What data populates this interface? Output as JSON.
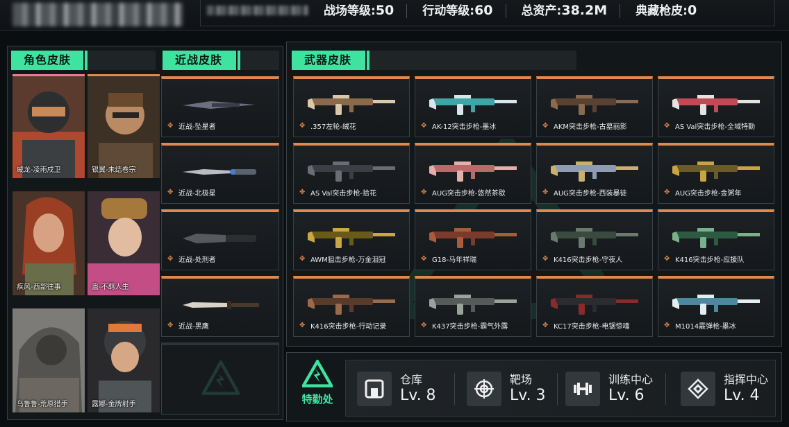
{
  "header": {
    "stats": [
      {
        "label": "战场等级:",
        "value": "50"
      },
      {
        "label": "行动等级:",
        "value": "60"
      },
      {
        "label": "总资产:",
        "value": "38.2M"
      },
      {
        "label": "典藏枪皮:",
        "value": "0"
      }
    ]
  },
  "character_skins": {
    "title": "角色皮肤",
    "items": [
      {
        "name": "威龙-凌雨戍卫"
      },
      {
        "name": "银翼-未结卷宗"
      },
      {
        "name": "疾风-西部往事"
      },
      {
        "name": "蛊-不羁人生"
      },
      {
        "name": "乌鲁鲁-荒原猎手"
      },
      {
        "name": "露娜-金牌射手"
      }
    ]
  },
  "melee_skins": {
    "title": "近战皮肤",
    "items": [
      {
        "name": "近战-坠星者"
      },
      {
        "name": "近战-北极星"
      },
      {
        "name": "近战-处刑者"
      },
      {
        "name": "近战-黑鹰"
      }
    ]
  },
  "weapon_skins": {
    "title": "武器皮肤",
    "items": [
      {
        "name": ".357左轮-绒花"
      },
      {
        "name": "AK-12突击步枪-墨冰"
      },
      {
        "name": "AKM突击步枪-古墓丽影"
      },
      {
        "name": "AS Val突击步枪-全域特勤"
      },
      {
        "name": "AS Val突击步枪-拾花"
      },
      {
        "name": "AUG突击步枪-悠然茶歇"
      },
      {
        "name": "AUG突击步枪-西装暴徒"
      },
      {
        "name": "AUG突击步枪-金粥年"
      },
      {
        "name": "AWM狙击步枪-万金泪冠"
      },
      {
        "name": "G18-马年祥瑞"
      },
      {
        "name": "K416突击步枪-守夜人"
      },
      {
        "name": "K416突击步枪-应援队"
      },
      {
        "name": "K416突击步枪-行动记录"
      },
      {
        "name": "K437突击步枪-霸气外露"
      },
      {
        "name": "KC17突击步枪-电锯惊魂"
      },
      {
        "name": "M1014霰弹枪-墨冰"
      }
    ]
  },
  "bottom": {
    "special_ops_label": "特勤处",
    "facilities": [
      {
        "name": "仓库",
        "level": "Lv. 8",
        "icon": "warehouse-icon"
      },
      {
        "name": "靶场",
        "level": "Lv. 3",
        "icon": "target-icon"
      },
      {
        "name": "训练中心",
        "level": "Lv. 6",
        "icon": "dumbbell-icon"
      },
      {
        "name": "指挥中心",
        "level": "Lv. 4",
        "icon": "command-center-icon"
      }
    ]
  },
  "colors": {
    "accent_green": "#3fe3a0",
    "rarity_orange": "#e0894e",
    "rarity_pink": "#ec7b8b"
  }
}
